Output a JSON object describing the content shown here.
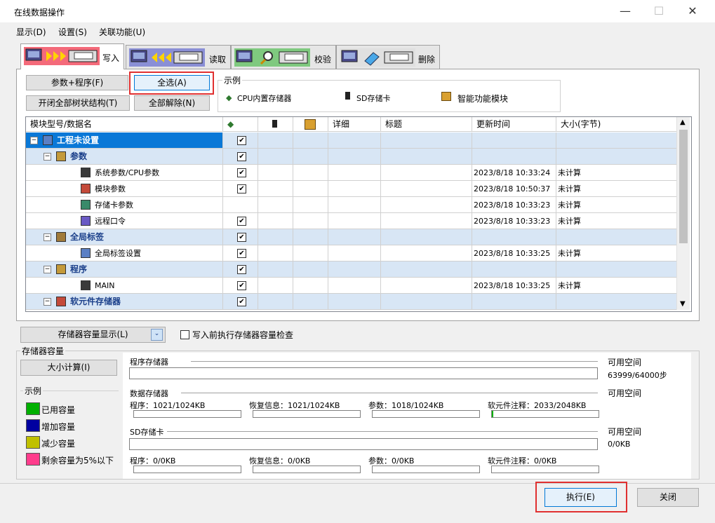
{
  "window": {
    "title": "在线数据操作",
    "min": "—",
    "max": "☐",
    "close": "✕"
  },
  "menu": [
    "显示(D)",
    "设置(S)",
    "关联功能(U)"
  ],
  "tabs": [
    {
      "label": "写入",
      "active": true
    },
    {
      "label": "读取",
      "active": false
    },
    {
      "label": "校验",
      "active": false
    },
    {
      "label": "删除",
      "active": false
    }
  ],
  "buttons": {
    "param_program": "参数+程序(F)",
    "select_all": "全选(A)",
    "toggle_tree": "开闭全部树状结构(T)",
    "deselect_all": "全部解除(N)"
  },
  "legend": {
    "title": "示例",
    "cpu": "CPU内置存储器",
    "sd": "SD存储卡",
    "module": "智能功能模块"
  },
  "grid": {
    "headers": [
      "模块型号/数据名",
      "",
      "",
      "",
      "详细",
      "标题",
      "更新时间",
      "大小(字节)"
    ],
    "rows": [
      {
        "name": "工程未设置",
        "level": 0,
        "group": true,
        "selected": true,
        "checked": true,
        "time": "",
        "size": ""
      },
      {
        "name": "参数",
        "level": 1,
        "group": true,
        "checked": true,
        "time": "",
        "size": ""
      },
      {
        "name": "系统参数/CPU参数",
        "level": 2,
        "checked": true,
        "time": "2023/8/18 10:33:24",
        "size": "未计算"
      },
      {
        "name": "模块参数",
        "level": 2,
        "checked": true,
        "time": "2023/8/18 10:50:37",
        "size": "未计算"
      },
      {
        "name": "存储卡参数",
        "level": 2,
        "checked": false,
        "time": "2023/8/18 10:33:23",
        "size": "未计算"
      },
      {
        "name": "远程口令",
        "level": 2,
        "checked": true,
        "time": "2023/8/18 10:33:23",
        "size": "未计算"
      },
      {
        "name": "全局标签",
        "level": 1,
        "group": true,
        "checked": true,
        "time": "",
        "size": ""
      },
      {
        "name": "全局标签设置",
        "level": 2,
        "checked": true,
        "time": "2023/8/18 10:33:25",
        "size": "未计算"
      },
      {
        "name": "程序",
        "level": 1,
        "group": true,
        "checked": true,
        "time": "",
        "size": ""
      },
      {
        "name": "MAIN",
        "level": 2,
        "checked": true,
        "time": "2023/8/18 10:33:25",
        "size": "未计算"
      },
      {
        "name": "软元件存储器",
        "level": 1,
        "group": true,
        "checked": true,
        "time": "",
        "size": ""
      }
    ]
  },
  "memory": {
    "toggle_button": "存储器容量显示(L)",
    "precheck_label": "写入前执行存储器容量检查",
    "section_title": "存储器容量",
    "calc_button": "大小计算(I)",
    "legend_title": "示例",
    "legend": [
      {
        "label": "已用容量",
        "color": "#00b000"
      },
      {
        "label": "增加容量",
        "color": "#0000a0"
      },
      {
        "label": "减少容量",
        "color": "#c0c000"
      },
      {
        "label": "剩余容量为5%以下",
        "color": "#ff3c8c"
      }
    ],
    "program_memory": {
      "title": "程序存储器",
      "avail_label": "可用空间",
      "avail_value": "63999/64000步"
    },
    "data_memory": {
      "title": "数据存储器",
      "avail_label": "可用空间",
      "program": "程序：1021/1024KB",
      "restore": "恢复信息：1021/1024KB",
      "param": "参数：1018/1024KB",
      "comment": "软元件注释：2033/2048KB"
    },
    "sd_card": {
      "title": "SD存储卡",
      "avail_label": "可用空间",
      "avail_value": "0/0KB",
      "program": "程序：0/0KB",
      "restore": "恢复信息：0/0KB",
      "param": "参数：0/0KB",
      "comment": "软元件注释：0/0KB"
    }
  },
  "footer": {
    "execute": "执行(E)",
    "close": "关闭"
  }
}
